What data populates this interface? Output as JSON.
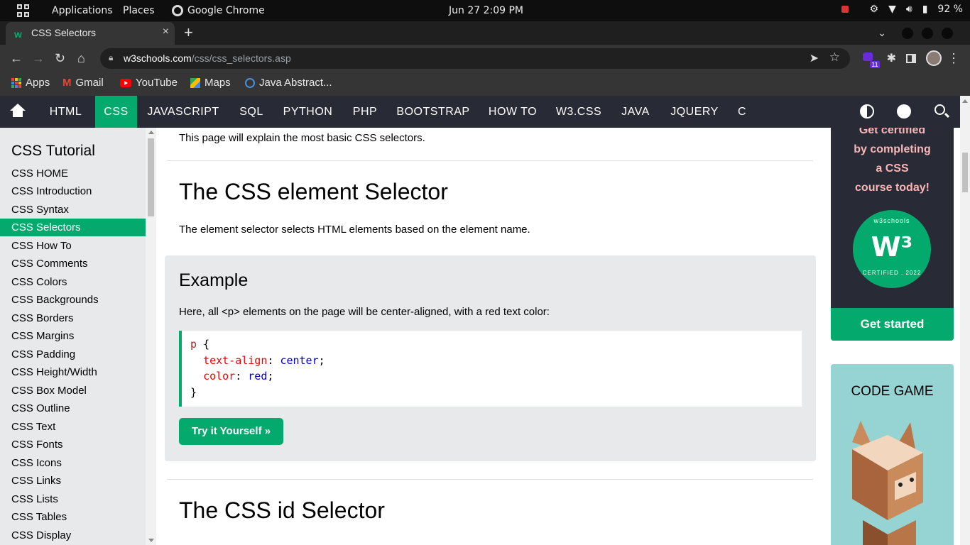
{
  "os_bar": {
    "applications": "Applications",
    "places": "Places",
    "active_app": "Google Chrome",
    "clock": "Jun 27   2:09 PM",
    "battery": "92 %"
  },
  "browser": {
    "tab_title": "CSS Selectors",
    "tab_close": "×",
    "new_tab": "+",
    "url_host": "w3schools.com",
    "url_path": "/css/css_selectors.asp",
    "extension_count": "11"
  },
  "bookmarks": [
    {
      "label": "Apps",
      "icon": "apps-grid-icon"
    },
    {
      "label": "Gmail",
      "icon": "gmail-icon"
    },
    {
      "label": "YouTube",
      "icon": "youtube-icon"
    },
    {
      "label": "Maps",
      "icon": "maps-icon"
    },
    {
      "label": "Java Abstract...",
      "icon": "java-icon"
    }
  ],
  "topnav": {
    "items": [
      "HTML",
      "CSS",
      "JAVASCRIPT",
      "SQL",
      "PYTHON",
      "PHP",
      "BOOTSTRAP",
      "HOW TO",
      "W3.CSS",
      "JAVA",
      "JQUERY",
      "C"
    ],
    "active": "CSS"
  },
  "sidebar": {
    "title": "CSS Tutorial",
    "links": [
      "CSS HOME",
      "CSS Introduction",
      "CSS Syntax",
      "CSS Selectors",
      "CSS How To",
      "CSS Comments",
      "CSS Colors",
      "CSS Backgrounds",
      "CSS Borders",
      "CSS Margins",
      "CSS Padding",
      "CSS Height/Width",
      "CSS Box Model",
      "CSS Outline",
      "CSS Text",
      "CSS Fonts",
      "CSS Icons",
      "CSS Links",
      "CSS Lists",
      "CSS Tables",
      "CSS Display"
    ],
    "active": "CSS Selectors"
  },
  "main": {
    "intro": "This page will explain the most basic CSS selectors.",
    "h1_element": "The CSS element Selector",
    "element_desc": "The element selector selects HTML elements based on the element name.",
    "example": {
      "heading": "Example",
      "desc": "Here, all <p> elements on the page will be center-aligned, with a red text color:",
      "code": {
        "selector": "p",
        "open": " {",
        "line1_prop": "text-align",
        "line1_val": "center",
        "line2_prop": "color",
        "line2_val": "red",
        "close": "}"
      },
      "try_button": "Try it Yourself »"
    },
    "h1_id": "The CSS id Selector"
  },
  "ads": {
    "cert_lines": [
      "Get certified",
      "by completing",
      "a CSS",
      "course today!"
    ],
    "badge_top": "w3schools",
    "badge_bottom": "CERTIFIED . 2022",
    "badge_logo": "W³",
    "get_started": "Get started",
    "code_game": "CODE GAME"
  },
  "colors": {
    "brand_green": "#04aa6d",
    "nav_dark": "#282a35",
    "sidebar_bg": "#e7e9eb",
    "code_game_bg": "#96d4d4"
  }
}
